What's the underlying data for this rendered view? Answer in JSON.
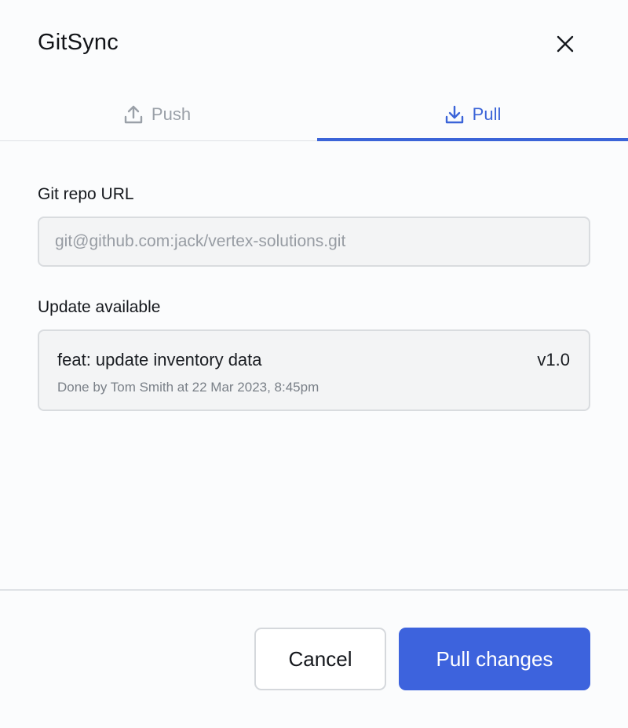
{
  "dialog": {
    "title": "GitSync",
    "close_icon": "close-icon"
  },
  "tabs": [
    {
      "label": "Push",
      "icon": "upload-icon",
      "active": false
    },
    {
      "label": "Pull",
      "icon": "download-icon",
      "active": true
    }
  ],
  "repo": {
    "label": "Git repo URL",
    "value": "git@github.com:jack/vertex-solutions.git"
  },
  "update": {
    "label": "Update available",
    "commit_message": "feat: update inventory data",
    "version": "v1.0",
    "meta": "Done by Tom Smith at 22 Mar 2023, 8:45pm"
  },
  "footer": {
    "cancel_label": "Cancel",
    "primary_label": "Pull changes"
  },
  "colors": {
    "accent": "#3d63dd",
    "inactive_tab": "#9aa0a8",
    "field_bg": "#f3f4f5",
    "border": "#d9dcdf"
  }
}
